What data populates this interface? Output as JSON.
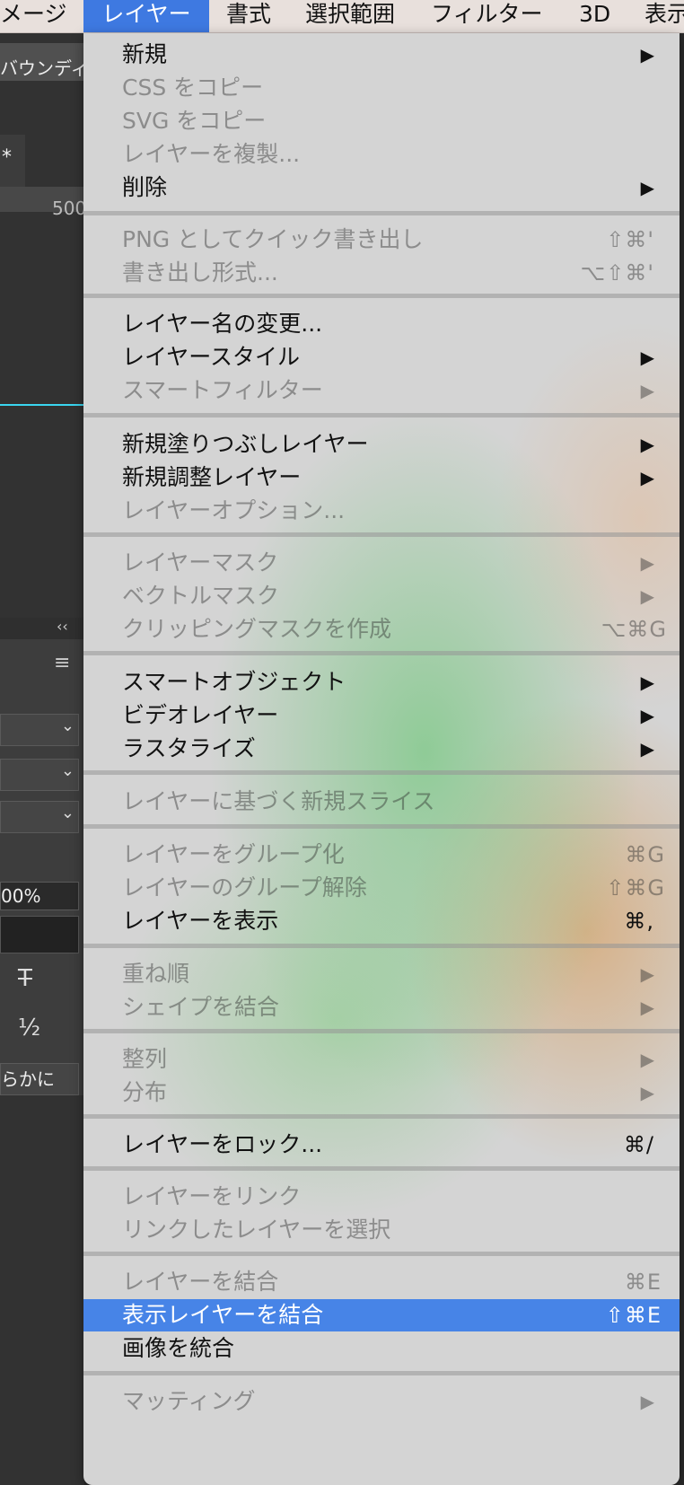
{
  "menubar": {
    "items": [
      {
        "label": "メージ"
      },
      {
        "label": "レイヤー"
      },
      {
        "label": "書式"
      },
      {
        "label": "選択範囲"
      },
      {
        "label": "フィルター"
      },
      {
        "label": "3D"
      },
      {
        "label": "表示"
      }
    ]
  },
  "background": {
    "options_text": "バウンディ",
    "doc_tab_star": "*",
    "ruler_value": "500",
    "opacity_value": "00%",
    "strike_glyph": "T",
    "half_glyph": "½",
    "antialias_value": "らかに",
    "collapse_glyph": "‹‹",
    "panel_menu_glyph": "≡",
    "chevron": "⌄"
  },
  "menu": {
    "items": [
      {
        "label": "新規",
        "shortcut": "",
        "submenu": true,
        "enabled": true
      },
      {
        "label": "CSS をコピー",
        "shortcut": "",
        "submenu": false,
        "enabled": false
      },
      {
        "label": "SVG をコピー",
        "shortcut": "",
        "submenu": false,
        "enabled": false
      },
      {
        "label": "レイヤーを複製...",
        "shortcut": "",
        "submenu": false,
        "enabled": false
      },
      {
        "label": "削除",
        "shortcut": "",
        "submenu": true,
        "enabled": true
      },
      {
        "label": "PNG としてクイック書き出し",
        "shortcut": "⇧⌘'",
        "submenu": false,
        "enabled": false
      },
      {
        "label": "書き出し形式...",
        "shortcut": "⌥⇧⌘'",
        "submenu": false,
        "enabled": false
      },
      {
        "label": "レイヤー名の変更...",
        "shortcut": "",
        "submenu": false,
        "enabled": true
      },
      {
        "label": "レイヤースタイル",
        "shortcut": "",
        "submenu": true,
        "enabled": true
      },
      {
        "label": "スマートフィルター",
        "shortcut": "",
        "submenu": true,
        "enabled": false
      },
      {
        "label": "新規塗りつぶしレイヤー",
        "shortcut": "",
        "submenu": true,
        "enabled": true
      },
      {
        "label": "新規調整レイヤー",
        "shortcut": "",
        "submenu": true,
        "enabled": true
      },
      {
        "label": "レイヤーオプション...",
        "shortcut": "",
        "submenu": false,
        "enabled": false
      },
      {
        "label": "レイヤーマスク",
        "shortcut": "",
        "submenu": true,
        "enabled": false
      },
      {
        "label": "ベクトルマスク",
        "shortcut": "",
        "submenu": true,
        "enabled": false
      },
      {
        "label": "クリッピングマスクを作成",
        "shortcut": "⌥⌘G",
        "submenu": false,
        "enabled": false
      },
      {
        "label": "スマートオブジェクト",
        "shortcut": "",
        "submenu": true,
        "enabled": true
      },
      {
        "label": "ビデオレイヤー",
        "shortcut": "",
        "submenu": true,
        "enabled": true
      },
      {
        "label": "ラスタライズ",
        "shortcut": "",
        "submenu": true,
        "enabled": true
      },
      {
        "label": "レイヤーに基づく新規スライス",
        "shortcut": "",
        "submenu": false,
        "enabled": false
      },
      {
        "label": "レイヤーをグループ化",
        "shortcut": "⌘G",
        "submenu": false,
        "enabled": false
      },
      {
        "label": "レイヤーのグループ解除",
        "shortcut": "⇧⌘G",
        "submenu": false,
        "enabled": false
      },
      {
        "label": "レイヤーを表示",
        "shortcut": "⌘,",
        "submenu": false,
        "enabled": true
      },
      {
        "label": "重ね順",
        "shortcut": "",
        "submenu": true,
        "enabled": false
      },
      {
        "label": "シェイプを結合",
        "shortcut": "",
        "submenu": true,
        "enabled": false
      },
      {
        "label": "整列",
        "shortcut": "",
        "submenu": true,
        "enabled": false
      },
      {
        "label": "分布",
        "shortcut": "",
        "submenu": true,
        "enabled": false
      },
      {
        "label": "レイヤーをロック...",
        "shortcut": "⌘/",
        "submenu": false,
        "enabled": true
      },
      {
        "label": "レイヤーをリンク",
        "shortcut": "",
        "submenu": false,
        "enabled": false
      },
      {
        "label": "リンクしたレイヤーを選択",
        "shortcut": "",
        "submenu": false,
        "enabled": false
      },
      {
        "label": "レイヤーを結合",
        "shortcut": "⌘E",
        "submenu": false,
        "enabled": false
      },
      {
        "label": "表示レイヤーを結合",
        "shortcut": "⇧⌘E",
        "submenu": false,
        "enabled": true,
        "highlighted": true
      },
      {
        "label": "画像を統合",
        "shortcut": "",
        "submenu": false,
        "enabled": true
      },
      {
        "label": "マッティング",
        "shortcut": "",
        "submenu": true,
        "enabled": false
      }
    ],
    "submenu_arrow": "▶"
  },
  "colors": {
    "highlight": "#4784e7",
    "active_menubar": "#3e79e1",
    "guide": "#3ad6f0"
  }
}
